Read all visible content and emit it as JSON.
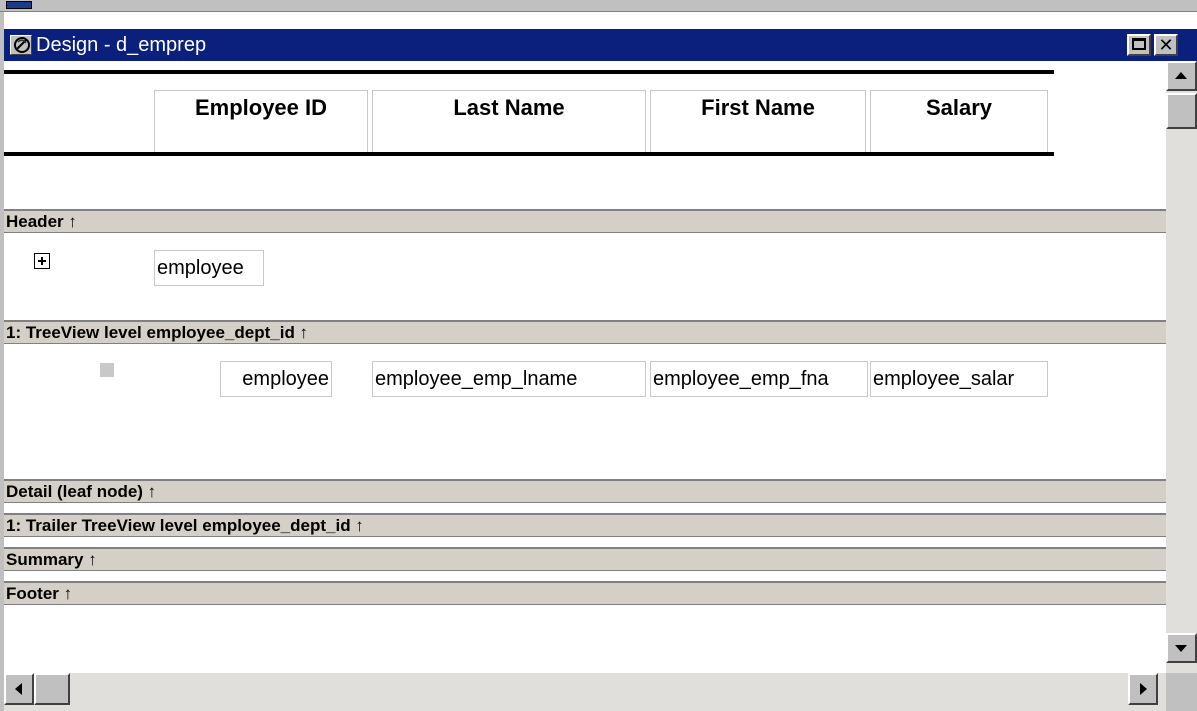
{
  "window": {
    "title": "Design - d_emprep",
    "icon": "datawindow-design-icon",
    "maximize_icon": "maximize-icon",
    "close_label": "✕",
    "titlebar_color": "#0b1f7c"
  },
  "columns": {
    "employee_id": "Employee ID",
    "last_name": "Last Name",
    "first_name": "First Name",
    "salary": "Salary"
  },
  "bands": {
    "header": "Header ↑",
    "treeview_level": "1: TreeView level employee_dept_id ↑",
    "detail": "Detail (leaf node) ↑",
    "trailer": "1: Trailer TreeView level employee_dept_id ↑",
    "summary": "Summary ↑",
    "footer": "Footer ↑"
  },
  "fields": {
    "header_employee": "employee",
    "level_employee": "employee",
    "emp_lname": "employee_emp_lname",
    "emp_fname": "employee_emp_fna",
    "salary": "employee_salar"
  },
  "icons": {
    "expand": "plus-expand-icon",
    "leaf": "leaf-node-icon",
    "scroll_up": "arrow-up-icon",
    "scroll_down": "arrow-down-icon",
    "scroll_left": "arrow-left-icon",
    "scroll_right": "arrow-right-icon"
  },
  "colors": {
    "band_bg": "#d4d0c8",
    "chrome": "#c0c0c0"
  }
}
